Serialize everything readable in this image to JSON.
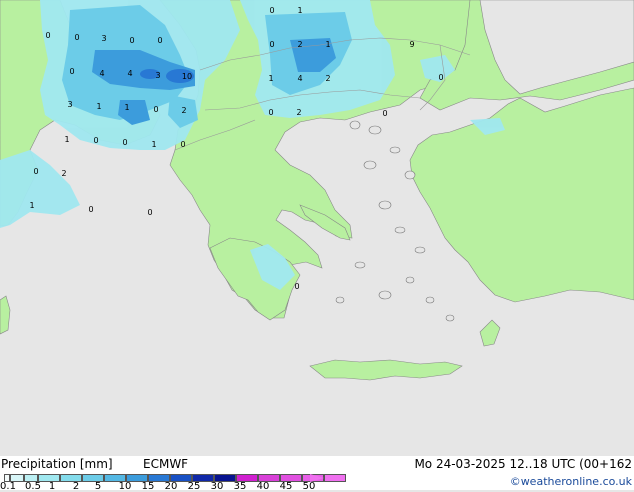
{
  "map": {
    "numbers": [
      {
        "t": "0",
        "c": "s"
      },
      {
        "t": "1",
        "c": "s"
      },
      {
        "t": "0",
        "c": "s"
      },
      {
        "t": "0",
        "c": "s"
      },
      {
        "t": "3",
        "c": "s"
      },
      {
        "t": "0",
        "c": "s"
      },
      {
        "t": "0",
        "c": "s"
      },
      {
        "t": "0",
        "c": "s"
      },
      {
        "t": "2",
        "c": "s"
      },
      {
        "t": "1",
        "c": "s"
      },
      {
        "t": "9",
        "c": "s"
      },
      {
        "t": "0",
        "c": "s"
      },
      {
        "t": "4",
        "c": "s"
      },
      {
        "t": "4",
        "c": "s"
      },
      {
        "t": "3",
        "c": "s"
      },
      {
        "t": "10",
        "c": "s"
      },
      {
        "t": "1",
        "c": "s"
      },
      {
        "t": "4",
        "c": "s"
      },
      {
        "t": "2",
        "c": "s"
      },
      {
        "t": "0",
        "c": "s"
      },
      {
        "t": "3",
        "c": "s"
      },
      {
        "t": "1",
        "c": "s"
      },
      {
        "t": "1",
        "c": "s"
      },
      {
        "t": "0",
        "c": "s"
      },
      {
        "t": "2",
        "c": "s"
      },
      {
        "t": "0",
        "c": "s"
      },
      {
        "t": "2",
        "c": "s"
      },
      {
        "t": "0",
        "c": "s"
      },
      {
        "t": "1",
        "c": "s"
      },
      {
        "t": "0",
        "c": "s"
      },
      {
        "t": "0",
        "c": "s"
      },
      {
        "t": "1",
        "c": "s"
      },
      {
        "t": "0",
        "c": "s"
      },
      {
        "t": "0",
        "c": "s"
      },
      {
        "t": "2",
        "c": "s"
      },
      {
        "t": "1",
        "c": "s"
      },
      {
        "t": "0",
        "c": "s"
      },
      {
        "t": "0",
        "c": "s"
      },
      {
        "t": "0",
        "c": "s"
      }
    ]
  },
  "footer": {
    "title": "Precipitation [mm]",
    "model": "ECMWF",
    "datetime": "Mo 24-03-2025 12..18 UTC (00+162",
    "credit": "©weatheronline.co.uk"
  },
  "legend": {
    "ticks": [
      "0.1",
      "0.5",
      "1",
      "2",
      "5",
      "10",
      "15",
      "20",
      "25",
      "30",
      "35",
      "40",
      "45",
      "50"
    ],
    "colors": [
      "#f5fcfc",
      "#d8f6f8",
      "#bcf0f4",
      "#a0e8f0",
      "#84dcec",
      "#6ccce8",
      "#54b8e4",
      "#3c9cdc",
      "#2878d4",
      "#1850c4",
      "#1028a8",
      "#081490",
      "#d020d0",
      "#d840d8",
      "#e050e0",
      "#e860e8",
      "#f070f0"
    ]
  },
  "colors": {
    "sea": "#e6e6e6",
    "land": "#b8f0a0",
    "coast": "#888888",
    "precip_light": "#a0e8f0",
    "precip_mid": "#6ccce8",
    "precip_heavy": "#3c9cdc",
    "precip_core": "#2878d4"
  }
}
